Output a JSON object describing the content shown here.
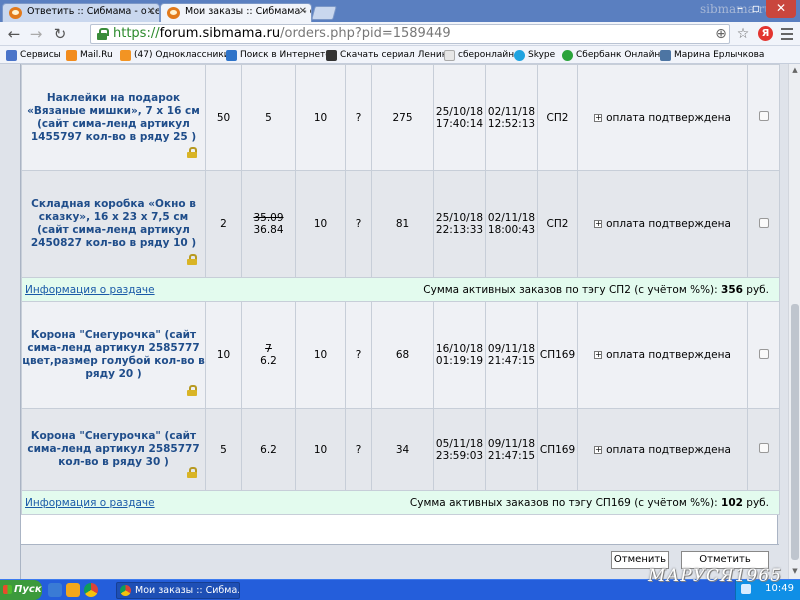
{
  "browser": {
    "tabs": [
      {
        "title": "Ответить :: Сибмама - о се",
        "active": false
      },
      {
        "title": "Мои заказы :: Сибмама - о",
        "active": true
      }
    ],
    "user_watermark": "sibmama.ru",
    "url": {
      "scheme": "https://",
      "host": "forum.sibmama.ru",
      "path": "/orders.php?pid=1589449"
    },
    "yandex_label": "Я",
    "bookmarks": [
      {
        "label": "Сервисы",
        "icon": "apps-icon",
        "color": "#4a74c9"
      },
      {
        "label": "Mail.Ru",
        "icon": "mailru-icon",
        "color": "#f28c1e"
      },
      {
        "label": "(47) Одноклассники",
        "icon": "ok-icon",
        "color": "#f29423"
      },
      {
        "label": "Поиск в Интернете",
        "icon": "search-web-icon",
        "color": "#2e73c9"
      },
      {
        "label": "Скачать сериал Ленин",
        "icon": "film-icon",
        "color": "#333333"
      },
      {
        "label": "сберонлайн",
        "icon": "page-icon",
        "color": "#d9d9d9"
      },
      {
        "label": "Skype",
        "icon": "skype-icon",
        "color": "#1fa3e0"
      },
      {
        "label": "Сбербанк Онлайн",
        "icon": "sberbank-icon",
        "color": "#2aa33a"
      },
      {
        "label": "Марина Ерлычкова",
        "icon": "vk-icon",
        "color": "#4d75a3"
      }
    ]
  },
  "orders": {
    "groups": [
      {
        "rows": [
          {
            "name": "Наклейки на подарок «Вязаные мишки», 7 х 16 см (сайт сима-ленд артикул 1455797 кол-во в ряду 25 )",
            "qty": "50",
            "price_old": "",
            "price": "5",
            "col4": "10",
            "col5": "?",
            "sum": "275",
            "date1": "25/10/18",
            "time1": "17:40:14",
            "date2": "02/11/18",
            "time2": "12:52:13",
            "tag": "СП2",
            "status": "оплата подтверждена"
          },
          {
            "name": "Складная коробка «Окно в сказку», 16 х 23 х 7,5 см (сайт сима-ленд артикул 2450827 кол-во в ряду 10 )",
            "qty": "2",
            "price_old": "35.09",
            "price": "36.84",
            "col4": "10",
            "col5": "?",
            "sum": "81",
            "date1": "25/10/18",
            "time1": "22:13:33",
            "date2": "02/11/18",
            "time2": "18:00:43",
            "tag": "СП2",
            "status": "оплата подтверждена"
          }
        ],
        "info_link": "Информация о раздаче",
        "summary_text": "Сумма активных заказов по тэгу СП2 (с учётом %%):",
        "summary_value": "356",
        "summary_unit": "руб."
      },
      {
        "rows": [
          {
            "name": "Корона \"Снегурочка\" (сайт сима-ленд артикул 2585777 цвет,размер голубой кол-во в ряду 20 )",
            "qty": "10",
            "price_old": "7",
            "price": "6.2",
            "col4": "10",
            "col5": "?",
            "sum": "68",
            "date1": "16/10/18",
            "time1": "01:19:19",
            "date2": "09/11/18",
            "time2": "21:47:15",
            "tag": "СП169",
            "status": "оплата подтверждена"
          },
          {
            "name": "Корона \"Снегурочка\" (сайт сима-ленд артикул 2585777 кол-во в ряду 30 )",
            "qty": "5",
            "price_old": "",
            "price": "6.2",
            "col4": "10",
            "col5": "?",
            "sum": "34",
            "date1": "05/11/18",
            "time1": "23:59:03",
            "date2": "09/11/18",
            "time2": "21:47:15",
            "tag": "СП169",
            "status": "оплата подтверждена"
          }
        ],
        "info_link": "Информация о раздаче",
        "summary_text": "Сумма активных заказов по тэгу СП169 (с учётом %%):",
        "summary_value": "102",
        "summary_unit": "руб."
      }
    ],
    "buttons": {
      "cancel": "Отменить",
      "mark": "Отметить"
    }
  },
  "taskbar": {
    "start_label": "Пуск",
    "window_title": "Мои заказы :: Сибма...",
    "clock": "10:49"
  },
  "watermark": "МАРУСЯ1965"
}
